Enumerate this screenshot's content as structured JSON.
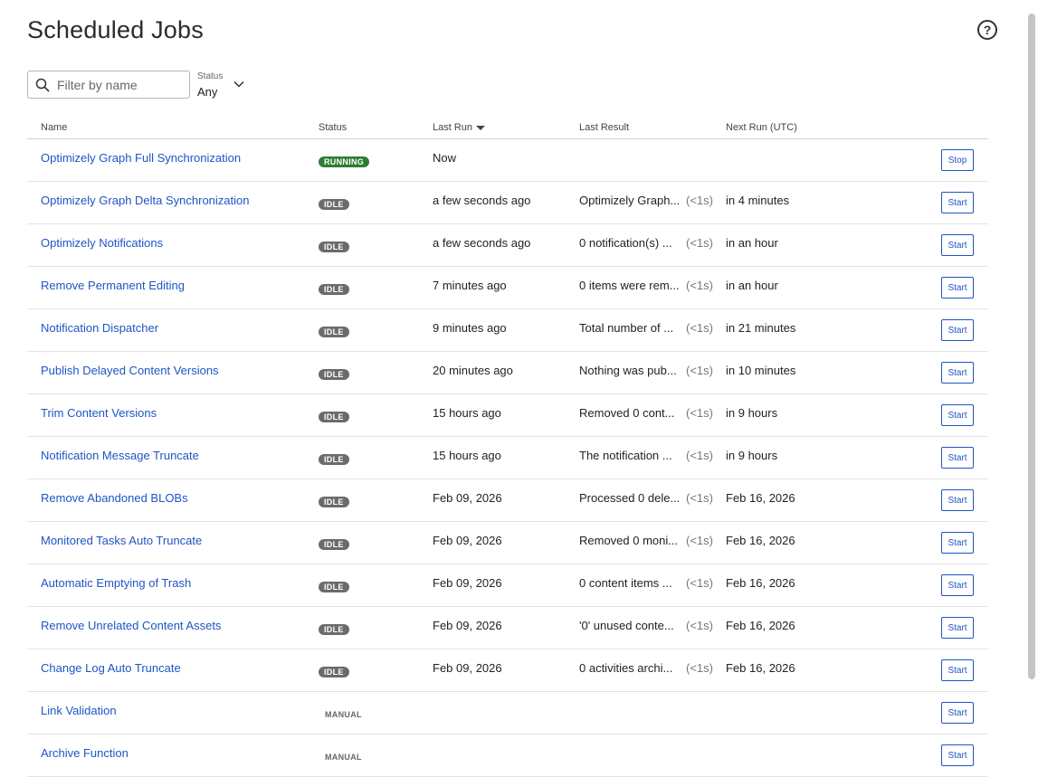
{
  "page": {
    "title": "Scheduled Jobs",
    "help": "?"
  },
  "filter": {
    "placeholder": "Filter by name",
    "status_label": "Status",
    "status_value": "Any"
  },
  "columns": {
    "name": "Name",
    "status": "Status",
    "last_run": "Last Run",
    "last_result": "Last Result",
    "next_run": "Next Run (UTC)"
  },
  "jobs": [
    {
      "name": "Optimizely Graph Full Synchronization",
      "status": "RUNNING",
      "last_run": "Now",
      "result": "",
      "duration": "",
      "next_run": "",
      "action": "Stop"
    },
    {
      "name": "Optimizely Graph Delta Synchronization",
      "status": "IDLE",
      "last_run": "a few seconds ago",
      "result": "Optimizely Graph...",
      "duration": "(<1s)",
      "next_run": "in 4 minutes",
      "action": "Start"
    },
    {
      "name": "Optimizely Notifications",
      "status": "IDLE",
      "last_run": "a few seconds ago",
      "result": "0 notification(s) ...",
      "duration": "(<1s)",
      "next_run": "in an hour",
      "action": "Start"
    },
    {
      "name": "Remove Permanent Editing",
      "status": "IDLE",
      "last_run": "7 minutes ago",
      "result": "0 items were rem...",
      "duration": "(<1s)",
      "next_run": "in an hour",
      "action": "Start"
    },
    {
      "name": "Notification Dispatcher",
      "status": "IDLE",
      "last_run": "9 minutes ago",
      "result": "Total number of ...",
      "duration": "(<1s)",
      "next_run": "in 21 minutes",
      "action": "Start"
    },
    {
      "name": "Publish Delayed Content Versions",
      "status": "IDLE",
      "last_run": "20 minutes ago",
      "result": "Nothing was pub...",
      "duration": "(<1s)",
      "next_run": "in 10 minutes",
      "action": "Start"
    },
    {
      "name": "Trim Content Versions",
      "status": "IDLE",
      "last_run": "15 hours ago",
      "result": "Removed 0 cont...",
      "duration": "(<1s)",
      "next_run": "in 9 hours",
      "action": "Start"
    },
    {
      "name": "Notification Message Truncate",
      "status": "IDLE",
      "last_run": "15 hours ago",
      "result": "The notification ...",
      "duration": "(<1s)",
      "next_run": "in 9 hours",
      "action": "Start"
    },
    {
      "name": "Remove Abandoned BLOBs",
      "status": "IDLE",
      "last_run": "Feb 09, 2026",
      "result": "Processed 0 dele...",
      "duration": "(<1s)",
      "next_run": "Feb 16, 2026",
      "action": "Start"
    },
    {
      "name": "Monitored Tasks Auto Truncate",
      "status": "IDLE",
      "last_run": "Feb 09, 2026",
      "result": "Removed 0 moni...",
      "duration": "(<1s)",
      "next_run": "Feb 16, 2026",
      "action": "Start"
    },
    {
      "name": "Automatic Emptying of Trash",
      "status": "IDLE",
      "last_run": "Feb 09, 2026",
      "result": "0 content items ...",
      "duration": "(<1s)",
      "next_run": "Feb 16, 2026",
      "action": "Start"
    },
    {
      "name": "Remove Unrelated Content Assets",
      "status": "IDLE",
      "last_run": "Feb 09, 2026",
      "result": "'0' unused conte...",
      "duration": "(<1s)",
      "next_run": "Feb 16, 2026",
      "action": "Start"
    },
    {
      "name": "Change Log Auto Truncate",
      "status": "IDLE",
      "last_run": "Feb 09, 2026",
      "result": "0 activities archi...",
      "duration": "(<1s)",
      "next_run": "Feb 16, 2026",
      "action": "Start"
    },
    {
      "name": "Link Validation",
      "status": "MANUAL",
      "last_run": "",
      "result": "",
      "duration": "",
      "next_run": "",
      "action": "Start"
    },
    {
      "name": "Archive Function",
      "status": "MANUAL",
      "last_run": "",
      "result": "",
      "duration": "",
      "next_run": "",
      "action": "Start"
    }
  ],
  "icons": {
    "search": "search-icon",
    "chevron": "chevron-down-icon",
    "sort": "sort-desc-icon",
    "help": "help-circle-icon"
  },
  "colors": {
    "link": "#1e55c4",
    "running": "#2e7d32",
    "idle": "#6b6b6b"
  }
}
